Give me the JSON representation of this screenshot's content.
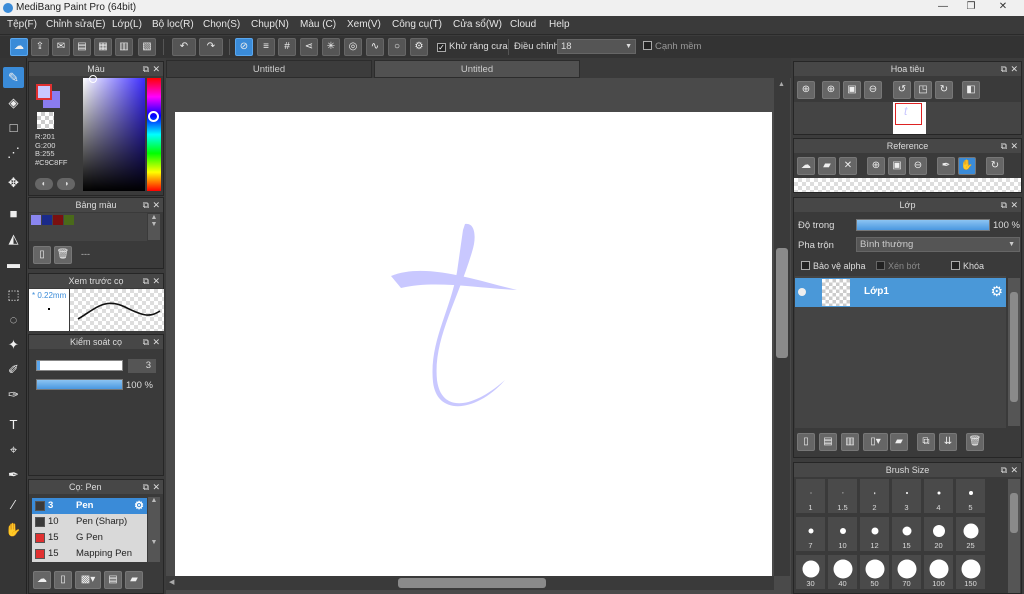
{
  "window": {
    "title": "MediBang Paint Pro (64bit)",
    "min": "—",
    "max": "❐",
    "close": "✕"
  },
  "menu": [
    "Tệp(F)",
    "Chỉnh sửa(E)",
    "Lớp(L)",
    "Bộ lọc(R)",
    "Chọn(S)",
    "Chụp(N)",
    "Màu (C)",
    "Xem(V)",
    "Công cụ(T)",
    "Cửa sổ(W)",
    "Cloud",
    "Help"
  ],
  "toolbar": {
    "antialias_label": "Khử răng cưa",
    "adjust_label": "Điều chỉnh",
    "adjust_value": "18",
    "soft_edge_label": "Cạnh mềm"
  },
  "tabs": [
    "Untitled",
    "Untitled"
  ],
  "color_panel": {
    "title": "Màu",
    "r": "R:201",
    "g": "G:200",
    "b": "B:255",
    "hex": "#C9C8FF",
    "fg_color": "#c9c8ff",
    "bg_color": "#8a7cf0"
  },
  "palette_panel": {
    "title": "Bảng màu",
    "colors": [
      "#8a86f0",
      "#1a2a8a",
      "#7a1010",
      "#4a6a1a"
    ],
    "placeholder": "---"
  },
  "preview_panel": {
    "title": "Xem trước cọ",
    "size": "* 0.22mm"
  },
  "brush_control": {
    "title": "Kiểm soát cọ",
    "size_value": "3",
    "opacity_value": "100 %",
    "size_fill": 0.03,
    "opacity_fill": 1.0
  },
  "brush_panel": {
    "title": "Cọ: Pen",
    "brushes": [
      {
        "size": "3",
        "name": "Pen",
        "color": "#3a3a3a",
        "selected": true
      },
      {
        "size": "10",
        "name": "Pen (Sharp)",
        "color": "#3a3a3a",
        "selected": false
      },
      {
        "size": "15",
        "name": "G Pen",
        "color": "#e03030",
        "selected": false
      },
      {
        "size": "15",
        "name": "Mapping Pen",
        "color": "#e03030",
        "selected": false
      }
    ]
  },
  "navigator": {
    "title": "Hoa tiêu"
  },
  "reference": {
    "title": "Reference"
  },
  "layer_panel": {
    "title": "Lớp",
    "opacity_label": "Độ trong",
    "opacity_value": "100 %",
    "opacity_fill": 1.0,
    "blend_label": "Pha trộn",
    "blend_value": "Bình thường",
    "protect_alpha": "Bảo vệ alpha",
    "clipping": "Xén bớt",
    "lock": "Khóa",
    "layers": [
      {
        "name": "Lớp1"
      }
    ]
  },
  "brush_size": {
    "title": "Brush Size",
    "sizes": [
      "1",
      "1.5",
      "2",
      "3",
      "4",
      "5",
      "7",
      "10",
      "12",
      "15",
      "20",
      "25",
      "30",
      "40",
      "50",
      "70",
      "100",
      "150"
    ]
  },
  "canvas": {
    "stroke_color": "#c9c8ff"
  }
}
